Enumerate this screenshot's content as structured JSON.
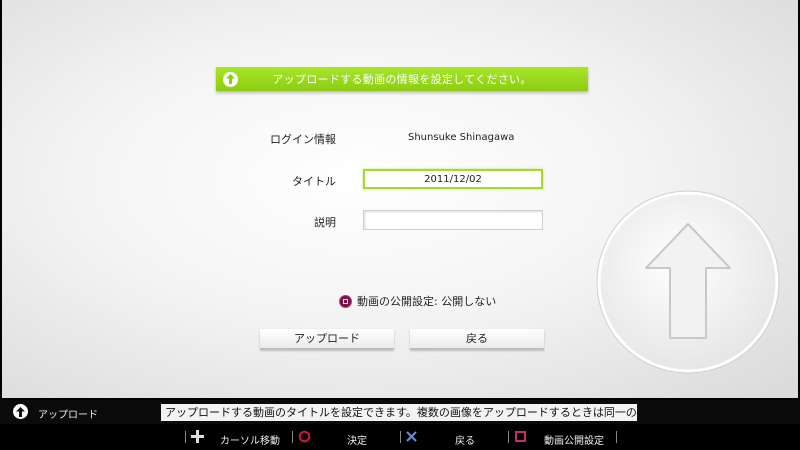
{
  "banner": {
    "text": "アップロードする動画の情報を設定してください。",
    "icon": "upload-arrow-icon"
  },
  "form": {
    "login": {
      "label": "ログイン情報",
      "value": "Shunsuke Shinagawa"
    },
    "title": {
      "label": "タイトル",
      "value": "2011/12/02"
    },
    "description": {
      "label": "説明",
      "value": ""
    }
  },
  "publish": {
    "icon": "square-button-icon",
    "text": "動画の公開設定: 公開しない"
  },
  "buttons": {
    "upload": "アップロード",
    "back": "戻る"
  },
  "statusbar": {
    "icon": "upload-arrow-icon",
    "label": "アップロード",
    "hint": "アップロードする動画のタイトルを設定できます。複数の画像をアップロードするときは同一の多"
  },
  "controls": [
    {
      "icon": "dpad-icon",
      "label": "カーソル移動"
    },
    {
      "icon": "circle-button-icon",
      "label": "決定"
    },
    {
      "icon": "cross-button-icon",
      "label": "戻る"
    },
    {
      "icon": "square-button-icon",
      "label": "動画公開設定"
    }
  ],
  "colors": {
    "accent": "#9ad61e",
    "circle": "#d0163a",
    "cross": "#6a8fd8",
    "square": "#c0306a"
  }
}
